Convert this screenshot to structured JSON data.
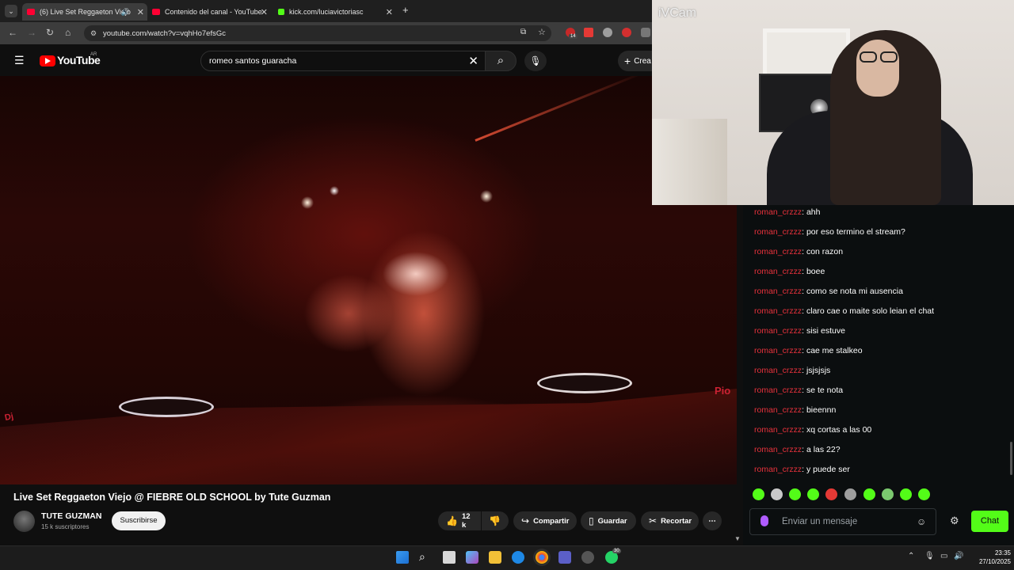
{
  "browser": {
    "tabs": [
      {
        "title": "(6) Live Set Reggaeton Viejo",
        "active": true,
        "favicon": "youtube-icon"
      },
      {
        "title": "Contenido del canal - YouTube",
        "active": false,
        "favicon": "youtube-icon"
      },
      {
        "title": "kick.com/luciavictoriasc",
        "active": false,
        "favicon": "kick-icon"
      }
    ],
    "new_tab": "+",
    "url": "youtube.com/watch?v=vqhHo7efsGc",
    "extension_badge": "14"
  },
  "youtube": {
    "logo": "YouTube",
    "country": "AR",
    "search_value": "romeo santos guaracha",
    "create_label": "Crea",
    "video": {
      "title": "Live Set Reggaeton Viejo @ FIEBRE OLD SCHOOL by Tute Guzman",
      "channel": "TUTE GUZMAN",
      "subscribers": "15 k suscriptores",
      "subscribe_label": "Suscribirse",
      "likes": "12 k",
      "share_label": "Compartir",
      "save_label": "Guardar",
      "clip_label": "Recortar",
      "overlay_text": "Pio",
      "overlay_text2": "Dj"
    }
  },
  "webcam": {
    "label": "iVCam"
  },
  "chat": {
    "messages": [
      {
        "user": "roman_crzzz",
        "text": "ahh"
      },
      {
        "user": "roman_crzzz",
        "text": "por eso termino el stream?"
      },
      {
        "user": "roman_crzzz",
        "text": "con razon"
      },
      {
        "user": "roman_crzzz",
        "text": "boee"
      },
      {
        "user": "roman_crzzz",
        "text": "como se nota mi ausencia"
      },
      {
        "user": "roman_crzzz",
        "text": "claro cae o maite solo leian el chat"
      },
      {
        "user": "roman_crzzz",
        "text": "sisi estuve"
      },
      {
        "user": "roman_crzzz",
        "text": "cae me stalkeo"
      },
      {
        "user": "roman_crzzz",
        "text": "jsjsjsjs"
      },
      {
        "user": "roman_crzzz",
        "text": "se te nota"
      },
      {
        "user": "roman_crzzz",
        "text": "bieennn"
      },
      {
        "user": "roman_crzzz",
        "text": "xq cortas a las 00"
      },
      {
        "user": "roman_crzzz",
        "text": "a las 22?"
      },
      {
        "user": "roman_crzzz",
        "text": "y puede ser"
      }
    ],
    "input_placeholder": "Enviar un mensaje",
    "send_label": "Chat",
    "user_color": "#e8323c",
    "accent": "#53fc18"
  },
  "taskbar": {
    "time": "23:35",
    "date": "27/10/2025",
    "whatsapp_badge": "30"
  }
}
